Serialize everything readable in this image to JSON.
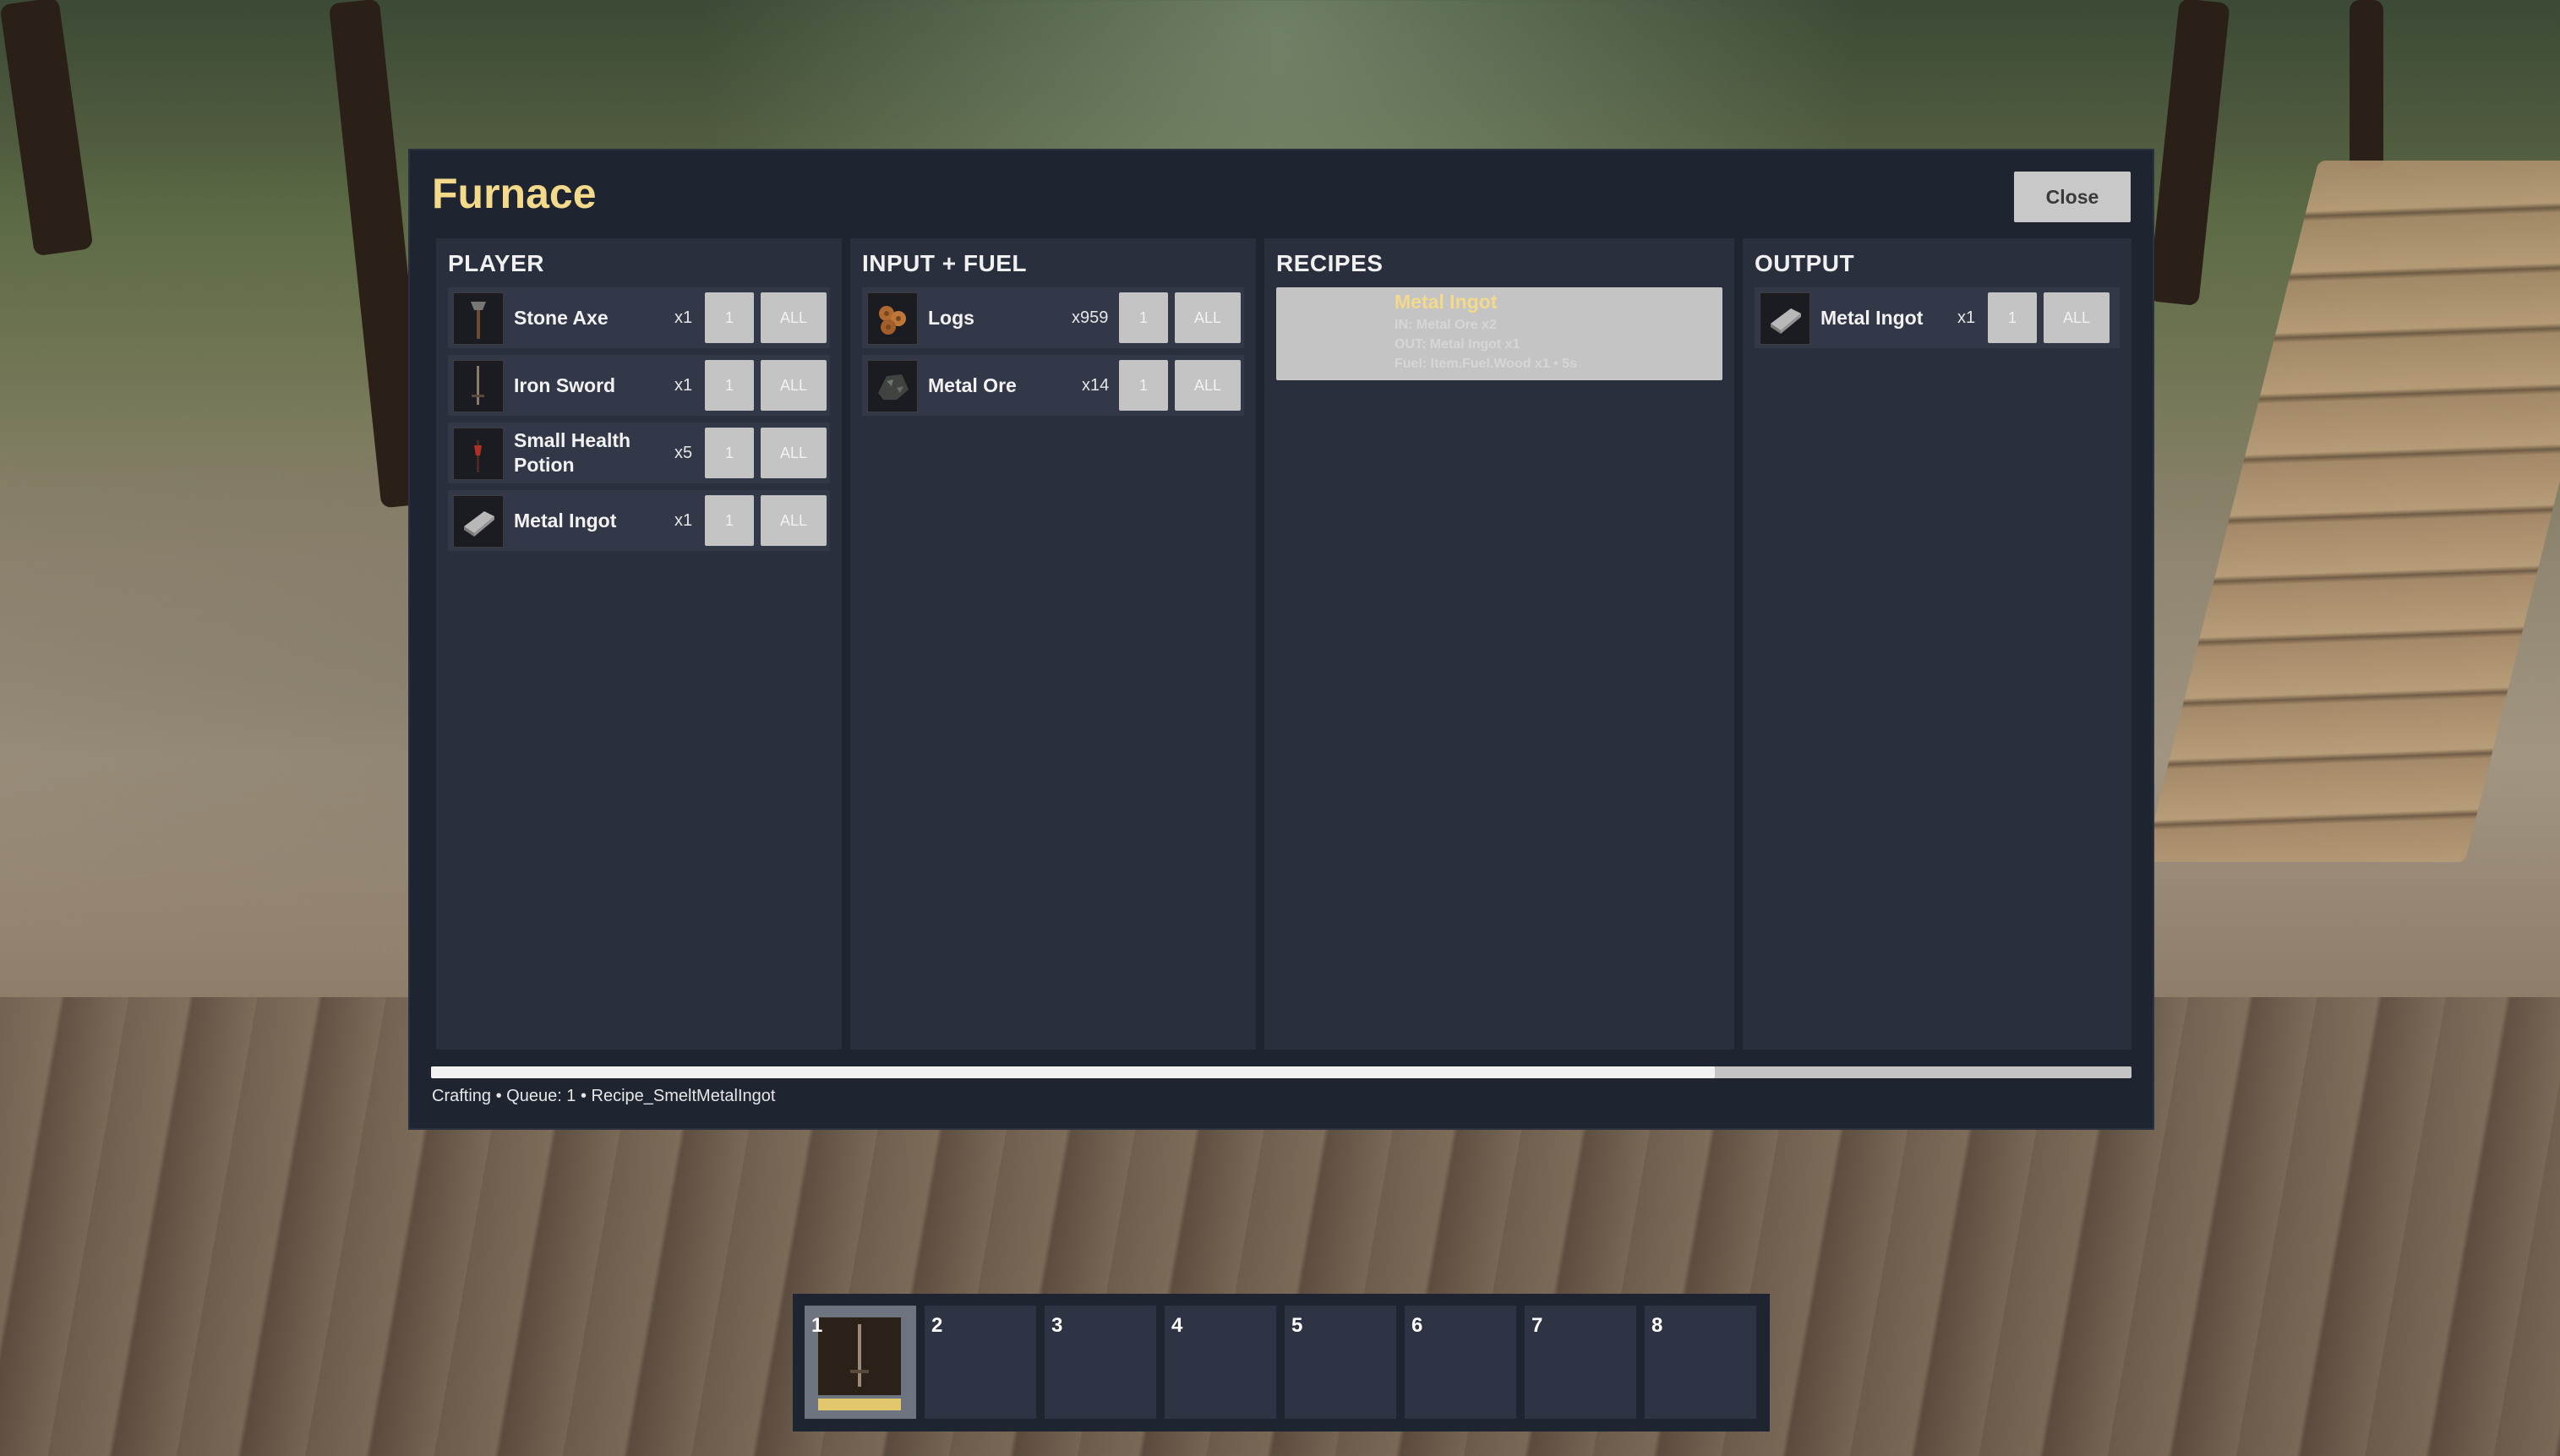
{
  "window": {
    "title": "Furnace",
    "close_label": "Close"
  },
  "panels": {
    "player": {
      "title": "PLAYER",
      "items": [
        {
          "name": "Stone Axe",
          "count": "x1",
          "icon": "stone-axe-icon"
        },
        {
          "name": "Iron Sword",
          "count": "x1",
          "icon": "iron-sword-icon"
        },
        {
          "name": "Small Health Potion",
          "count": "x5",
          "icon": "health-potion-icon"
        },
        {
          "name": "Metal Ingot",
          "count": "x1",
          "icon": "metal-ingot-icon"
        }
      ]
    },
    "input_fuel": {
      "title": "INPUT + FUEL",
      "items": [
        {
          "name": "Logs",
          "count": "x959",
          "icon": "logs-icon"
        },
        {
          "name": "Metal Ore",
          "count": "x14",
          "icon": "metal-ore-icon"
        }
      ]
    },
    "recipes": {
      "title": "RECIPES",
      "items": [
        {
          "name": "Metal Ingot",
          "in": "IN: Metal Ore x2",
          "out": "OUT: Metal Ingot x1",
          "fuel": "Fuel: Item.Fuel.Wood x1 • 5s"
        }
      ]
    },
    "output": {
      "title": "OUTPUT",
      "items": [
        {
          "name": "Metal Ingot",
          "count": "x1",
          "icon": "metal-ingot-icon"
        }
      ]
    }
  },
  "buttons": {
    "one_label": "1",
    "all_label": "ALL"
  },
  "progress": {
    "fraction": 0.755,
    "status_text": "Crafting • Queue: 1 • Recipe_SmeltMetalIngot"
  },
  "hotbar": {
    "active_slot": 1,
    "slots": [
      {
        "number": "1",
        "icon": "iron-sword-icon"
      },
      {
        "number": "2"
      },
      {
        "number": "3"
      },
      {
        "number": "4"
      },
      {
        "number": "5"
      },
      {
        "number": "6"
      },
      {
        "number": "7"
      },
      {
        "number": "8"
      }
    ]
  },
  "colors": {
    "title_accent": "#f3d98a",
    "panel_bg": "#2a2f3d",
    "window_bg": "#1f2431",
    "button_bg": "#c4c4c4",
    "hotbar_durability": "#e3c76c"
  }
}
